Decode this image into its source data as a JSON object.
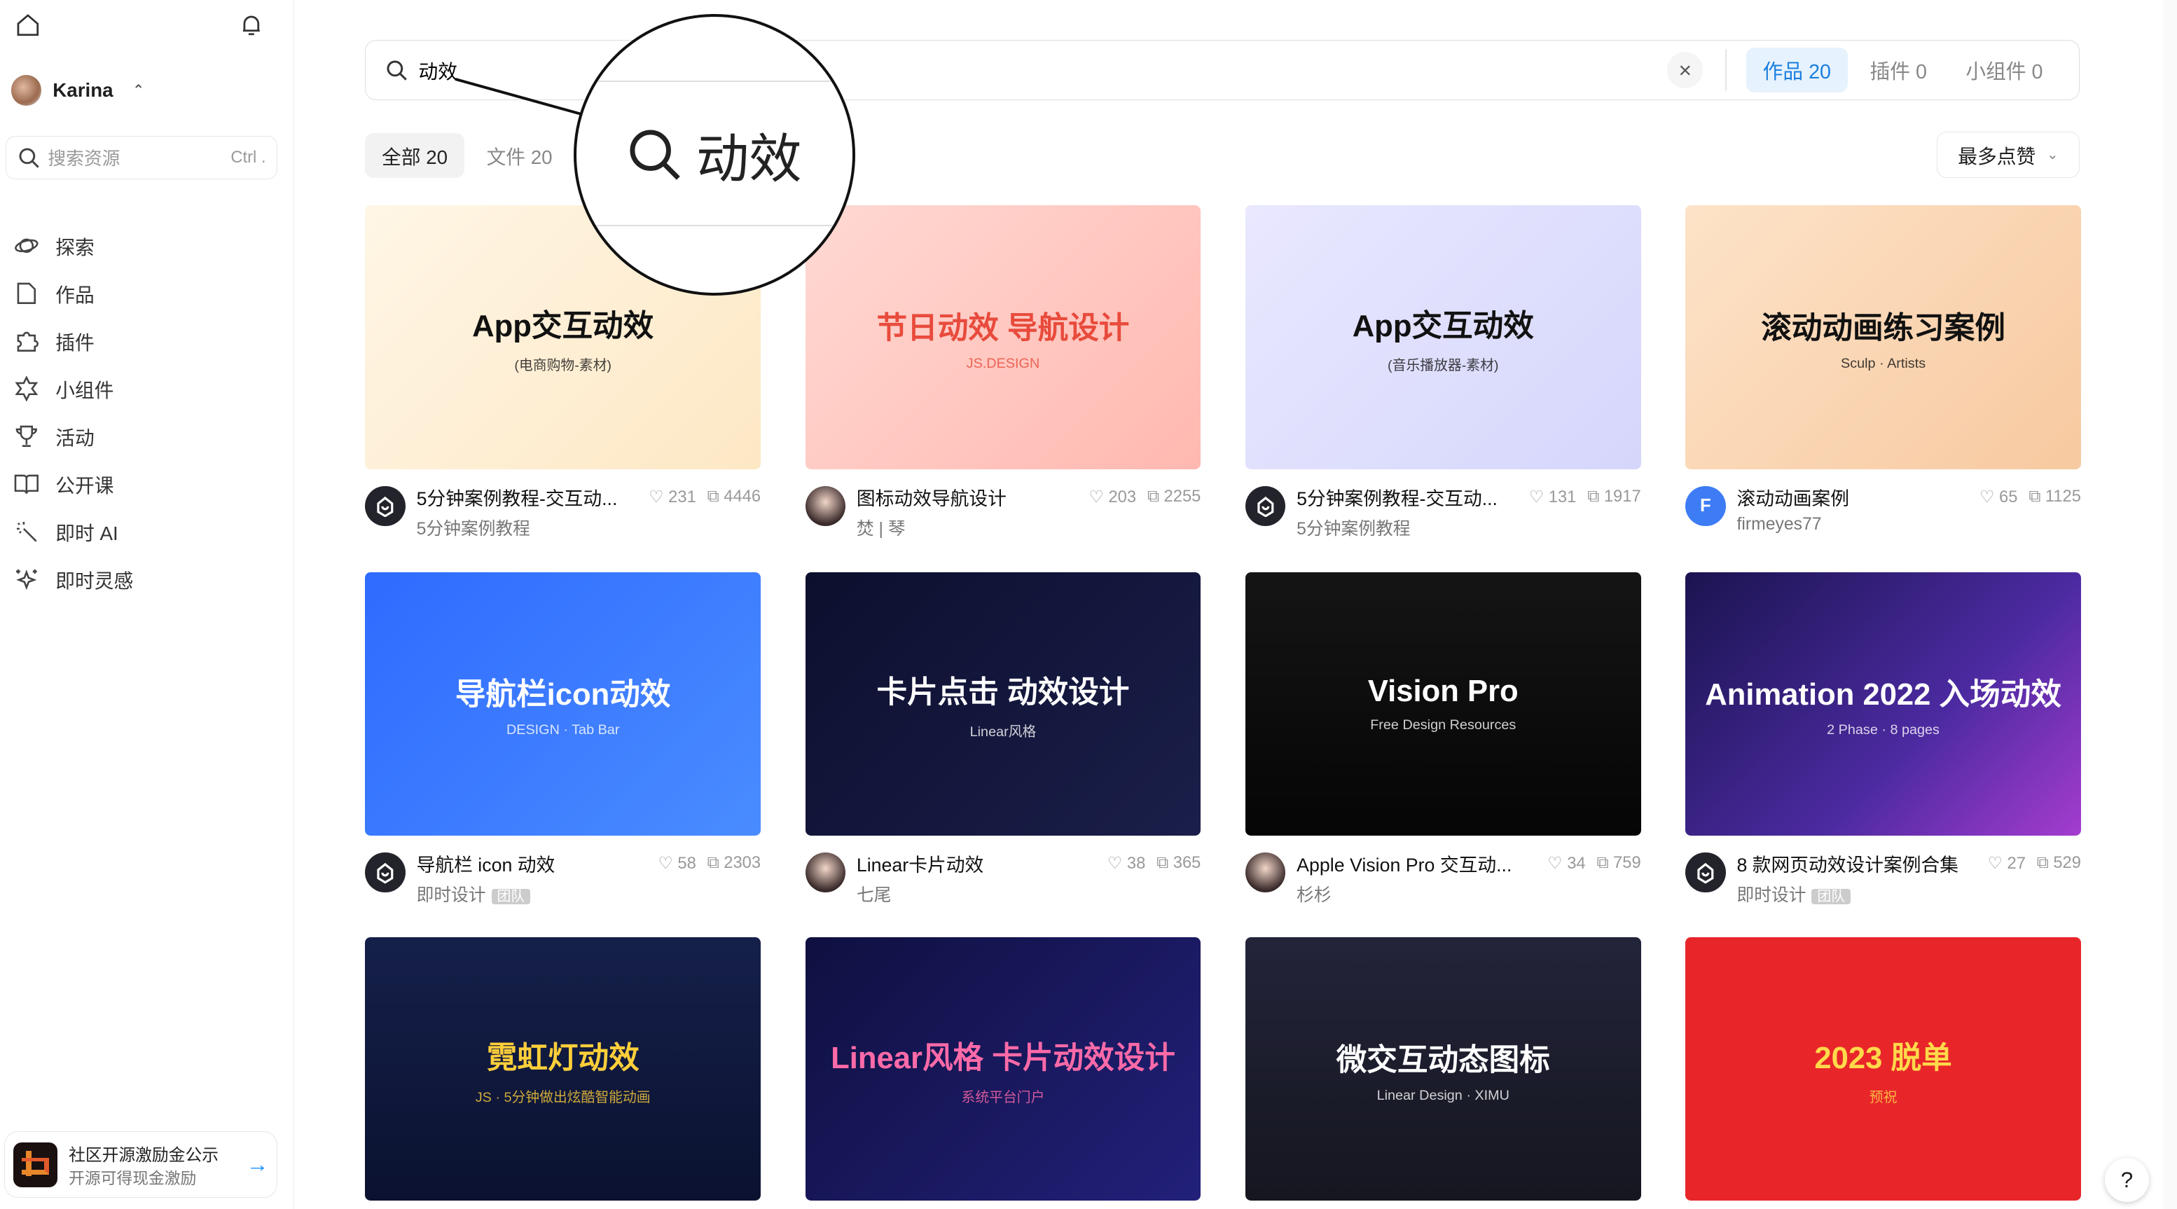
{
  "sidebar": {
    "user": {
      "name": "Karina"
    },
    "search": {
      "placeholder": "搜索资源",
      "shortcut": "Ctrl ."
    },
    "items": [
      {
        "label": "探索",
        "icon": "planet-icon"
      },
      {
        "label": "作品",
        "icon": "file-icon"
      },
      {
        "label": "插件",
        "icon": "puzzle-icon"
      },
      {
        "label": "小组件",
        "icon": "widget-star-icon"
      },
      {
        "label": "活动",
        "icon": "trophy-icon"
      },
      {
        "label": "公开课",
        "icon": "book-icon"
      },
      {
        "label": "即时 AI",
        "icon": "magic-wand-icon"
      },
      {
        "label": "即时灵感",
        "icon": "sparkles-icon"
      }
    ],
    "promo": {
      "title": "社区开源激励金公示",
      "subtitle": "开源可得现金激励"
    }
  },
  "search": {
    "value": "动效",
    "tabs": [
      {
        "label": "作品 20",
        "active": true
      },
      {
        "label": "插件 0"
      },
      {
        "label": "小组件 0"
      }
    ]
  },
  "filters": [
    {
      "label": "全部 20",
      "active": true
    },
    {
      "label": "文件 20"
    }
  ],
  "sort": {
    "label": "最多点赞"
  },
  "magnifier": {
    "text": "动效"
  },
  "accent": "#1a7fe0",
  "cards": [
    {
      "thumb_title": "App交互动效",
      "thumb_sub": "(电商购物-素材)",
      "title": "5分钟案例教程-交互动...",
      "likes": "231",
      "copies": "4446",
      "author": "5分钟案例教程",
      "avatar": "logo",
      "bg": "linear-gradient(135deg,#fff6e6,#fde8c4)",
      "fg": "#111"
    },
    {
      "thumb_title": "节日动效 导航设计",
      "thumb_sub": "JS.DESIGN",
      "title": "图标动效导航设计",
      "likes": "203",
      "copies": "2255",
      "author": "焚 | 琴",
      "avatar": "photo",
      "bg": "linear-gradient(135deg,#ffd9d3,#ffb8b0)",
      "fg": "#e84b3c"
    },
    {
      "thumb_title": "App交互动效",
      "thumb_sub": "(音乐播放器-素材)",
      "title": "5分钟案例教程-交互动...",
      "likes": "131",
      "copies": "1917",
      "author": "5分钟案例教程",
      "avatar": "logo",
      "bg": "linear-gradient(135deg,#e9e8ff,#d5d6fb)",
      "fg": "#111"
    },
    {
      "thumb_title": "滚动动画练习案例",
      "thumb_sub": "Sculp · Artists",
      "title": "滚动动画案例",
      "likes": "65",
      "copies": "1125",
      "author": "firmeyes77",
      "avatar": "F",
      "bg": "linear-gradient(135deg,#fde3c8,#f7c9a0)",
      "fg": "#111"
    },
    {
      "thumb_title": "导航栏icon动效",
      "thumb_sub": "DESIGN · Tab Bar",
      "title": "导航栏 icon 动效",
      "likes": "58",
      "copies": "2303",
      "author": "即时设计",
      "team": "团队",
      "avatar": "logo",
      "bg": "linear-gradient(135deg,#2f6bff,#4a8cff)",
      "fg": "#fff"
    },
    {
      "thumb_title": "卡片点击 动效设计",
      "thumb_sub": "Linear风格",
      "title": "Linear卡片动效",
      "likes": "38",
      "copies": "365",
      "author": "七尾",
      "avatar": "photo",
      "bg": "linear-gradient(135deg,#0d0f2e,#1a1f4a)",
      "fg": "#fff"
    },
    {
      "thumb_title": "Vision Pro",
      "thumb_sub": "Free Design Resources",
      "title": "Apple Vision Pro 交互动...",
      "likes": "34",
      "copies": "759",
      "author": "杉杉",
      "avatar": "photo",
      "bg": "linear-gradient(180deg,#151515,#050505)",
      "fg": "#fff"
    },
    {
      "thumb_title": "Animation 2022 入场动效",
      "thumb_sub": "2 Phase · 8 pages",
      "title": "8 款网页动效设计案例合集",
      "likes": "27",
      "copies": "529",
      "author": "即时设计",
      "team": "团队",
      "avatar": "logo",
      "bg": "linear-gradient(135deg,#1b1450,#4b2aa0 60%,#a43ccf)",
      "fg": "#fff"
    },
    {
      "thumb_title": "霓虹灯动效",
      "thumb_sub": "JS · 5分钟做出炫酷智能动画",
      "bg": "linear-gradient(180deg,#15204a,#0b1230)",
      "fg": "#ffcf3a"
    },
    {
      "thumb_title": "Linear风格 卡片动效设计",
      "thumb_sub": "系统平台门户",
      "bg": "linear-gradient(135deg,#0f1040,#22207a)",
      "fg": "#ff6aa8"
    },
    {
      "thumb_title": "微交互动态图标",
      "thumb_sub": "Linear Design · XIMU",
      "bg": "linear-gradient(180deg,#23243a,#15161f)",
      "fg": "#fff"
    },
    {
      "thumb_title": "2023 脱单",
      "thumb_sub": "预祝",
      "bg": "#e8262a",
      "fg": "#ffd94a"
    }
  ]
}
